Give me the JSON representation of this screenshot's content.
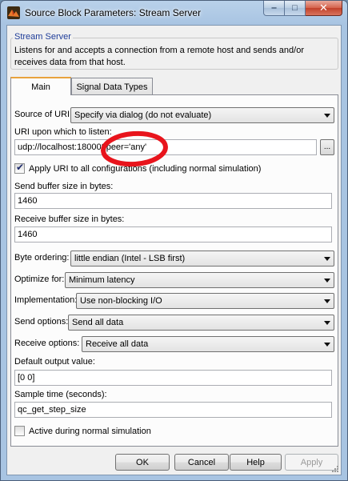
{
  "window": {
    "title": "Source Block Parameters: Stream Server"
  },
  "group": {
    "title": "Stream Server",
    "description": "Listens for and accepts a connection from a remote host and sends and/or receives data from that host."
  },
  "tabs": [
    {
      "label": "Main",
      "active": true
    },
    {
      "label": "Signal Data Types",
      "active": false
    }
  ],
  "params": {
    "source_of_uri": {
      "label": "Source of URI:",
      "value": "Specify via dialog (do not evaluate)"
    },
    "uri": {
      "label": "URI upon which to listen:",
      "value": "udp://localhost:18000?peer='any'",
      "browse": "..."
    },
    "apply_uri": {
      "label": "Apply URI to all configurations (including normal simulation)",
      "checked": true
    },
    "send_buffer": {
      "label": "Send buffer size in bytes:",
      "value": "1460"
    },
    "receive_buffer": {
      "label": "Receive buffer size in bytes:",
      "value": "1460"
    },
    "byte_ordering": {
      "label": "Byte ordering:",
      "value": "little endian (Intel - LSB first)"
    },
    "optimize_for": {
      "label": "Optimize for:",
      "value": "Minimum latency"
    },
    "implementation": {
      "label": "Implementation:",
      "value": "Use non-blocking I/O"
    },
    "send_options": {
      "label": "Send options:",
      "value": "Send all data"
    },
    "receive_options": {
      "label": "Receive options:",
      "value": "Receive all data"
    },
    "default_output": {
      "label": "Default output value:",
      "value": "[0 0]"
    },
    "sample_time": {
      "label": "Sample time (seconds):",
      "value": "qc_get_step_size"
    },
    "active_normal": {
      "label": "Active during normal simulation",
      "checked": false
    }
  },
  "buttons": {
    "ok": "OK",
    "cancel": "Cancel",
    "help": "Help",
    "apply": "Apply"
  },
  "colors": {
    "annotation": "#e8141c",
    "group_title": "#1f3d99",
    "active_tab_accent": "#e8a33d"
  }
}
